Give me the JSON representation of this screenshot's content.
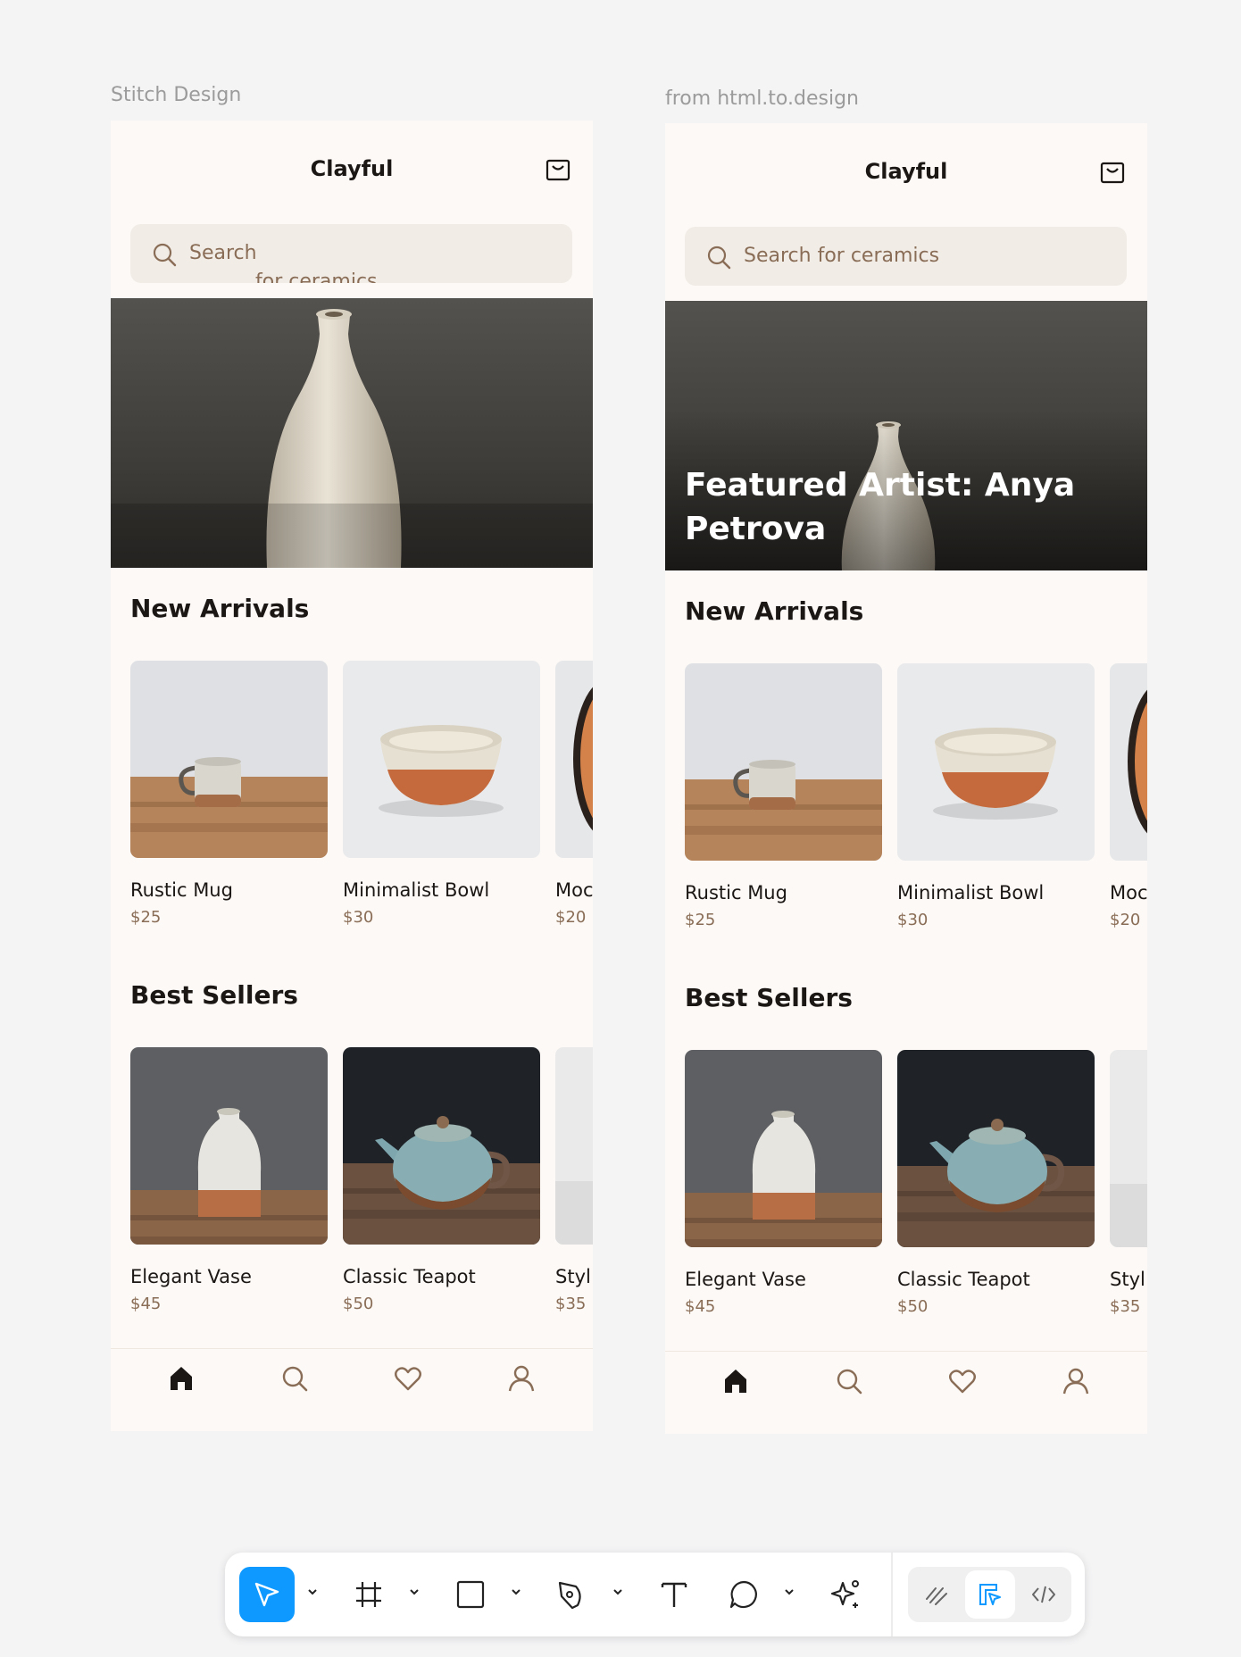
{
  "captions": {
    "left": "Stitch Design",
    "right": "from html.to.design"
  },
  "left": {
    "app_title": "Clayful",
    "search_placeholder": "Search",
    "search_placeholder_overflow": "for ceramics",
    "hero_title": "",
    "new_arrivals_title": "New Arrivals",
    "best_sellers_title": "Best Sellers"
  },
  "right": {
    "app_title": "Clayful",
    "search_placeholder": "Search for ceramics",
    "hero_title": "Featured Artist: Anya Petrova",
    "new_arrivals_title": "New Arrivals",
    "best_sellers_title": "Best Sellers"
  },
  "new_arrivals": [
    {
      "name": "Rustic Mug",
      "price": "$25",
      "image": "mug"
    },
    {
      "name": "Minimalist Bowl",
      "price": "$30",
      "image": "bowl"
    },
    {
      "name": "Moc",
      "price": "$20",
      "image": "plate"
    }
  ],
  "best_sellers": [
    {
      "name": "Elegant Vase",
      "price": "$45",
      "image": "vase"
    },
    {
      "name": "Classic Teapot",
      "price": "$50",
      "image": "teapot"
    },
    {
      "name": "Styl",
      "price": "$35",
      "image": "white"
    }
  ],
  "bottom_nav": [
    {
      "icon": "home-icon",
      "active": true
    },
    {
      "icon": "search-icon",
      "active": false
    },
    {
      "icon": "heart-icon",
      "active": false
    },
    {
      "icon": "user-icon",
      "active": false
    }
  ],
  "toolbar": {
    "tools": [
      "move-tool-icon",
      "frame-tool-icon",
      "rectangle-tool-icon",
      "pen-tool-icon",
      "text-tool-icon",
      "comment-tool-icon",
      "ai-tool-icon"
    ],
    "modes": [
      "draw-mode-icon",
      "design-mode-icon",
      "dev-mode-icon"
    ],
    "accent": "#0d99ff"
  },
  "colors": {
    "brown_text": "#8a6d56",
    "dark_text": "#1b1714",
    "frame_bg": "#fcf9f6",
    "search_bg": "#f1ece6"
  }
}
